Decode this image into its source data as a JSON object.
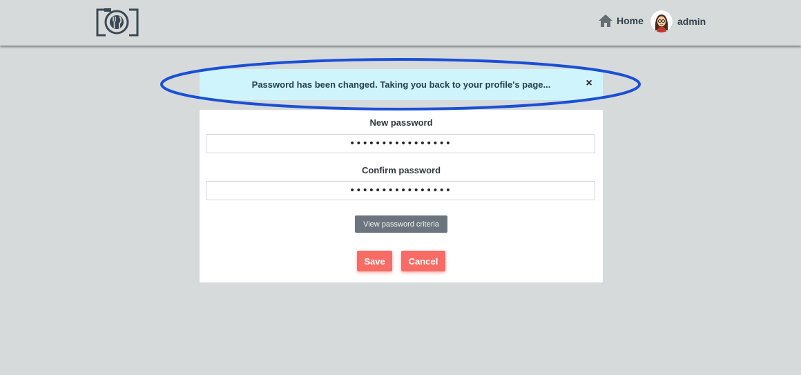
{
  "nav": {
    "home_label": "Home",
    "user_label": "admin"
  },
  "alert": {
    "message": "Password has been changed. Taking you back to your profile's page...",
    "close_symbol": "×"
  },
  "form": {
    "new_password_label": "New password",
    "new_password_value": "••••••••••••••••",
    "confirm_password_label": "Confirm password",
    "confirm_password_value": "••••••••••••••••",
    "criteria_button_label": "View password criteria",
    "save_label": "Save",
    "cancel_label": "Cancel"
  },
  "colors": {
    "background": "#d6dadb",
    "alert_bg": "#cff4fc",
    "primary_button": "#f86c65",
    "secondary_button": "#6c757d",
    "highlight_ring": "#1a4fd6"
  },
  "icons": [
    "camera-plate-logo",
    "home-icon",
    "avatar",
    "close-icon"
  ]
}
